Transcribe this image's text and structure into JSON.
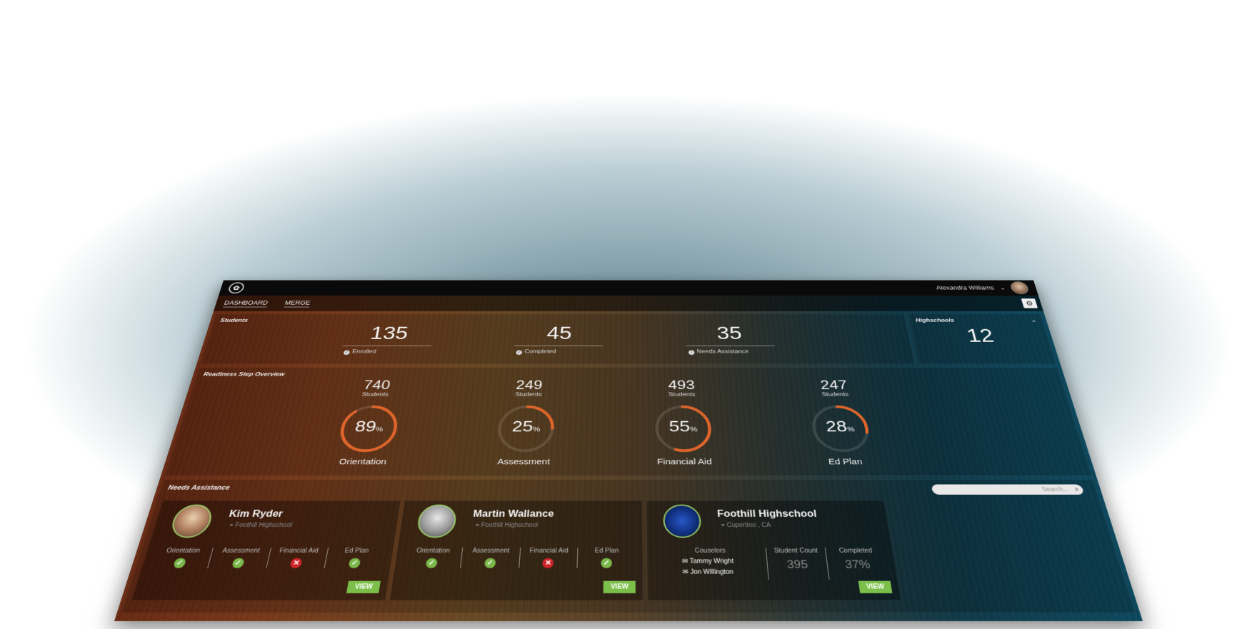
{
  "header": {
    "user_name": "Alexandra Williams",
    "user_menu_chevron": "⌄"
  },
  "nav": {
    "tabs": [
      {
        "label": "DASHBOARD"
      },
      {
        "label": "MERGE"
      }
    ]
  },
  "students": {
    "title": "Students",
    "stats": [
      {
        "value": "135",
        "label": "Enrolled"
      },
      {
        "value": "45",
        "label": "Completed"
      },
      {
        "value": "35",
        "label": "Needs Assistance"
      }
    ]
  },
  "highschools": {
    "title": "Highschools",
    "value": "12"
  },
  "readiness": {
    "title": "Readiness Step Overview",
    "steps": [
      {
        "count": "740",
        "sub": "Students",
        "percent": 89,
        "percent_label": "89",
        "name": "Orientation"
      },
      {
        "count": "249",
        "sub": "Students",
        "percent": 25,
        "percent_label": "25",
        "name": "Assessment"
      },
      {
        "count": "493",
        "sub": "Students",
        "percent": 55,
        "percent_label": "55",
        "name": "Financial Aid"
      },
      {
        "count": "247",
        "sub": "Students",
        "percent": 28,
        "percent_label": "28",
        "name": "Ed Plan"
      }
    ],
    "percent_sign": "%"
  },
  "needs": {
    "title": "Needs Assistance",
    "search_placeholder": "Search...",
    "cards": [
      {
        "name": "Kim Ryder",
        "location": "Foothill Highschool",
        "checks": [
          {
            "label": "Orientation",
            "status": "ok"
          },
          {
            "label": "Assessment",
            "status": "ok"
          },
          {
            "label": "Financial Aid",
            "status": "bad"
          },
          {
            "label": "Ed Plan",
            "status": "ok"
          }
        ],
        "view_label": "VIEW"
      },
      {
        "name": "Martin Wallance",
        "location": "Foothill Highschool",
        "checks": [
          {
            "label": "Orientation",
            "status": "ok"
          },
          {
            "label": "Assessment",
            "status": "ok"
          },
          {
            "label": "Financial Aid",
            "status": "bad"
          },
          {
            "label": "Ed Plan",
            "status": "ok"
          }
        ],
        "view_label": "VIEW"
      }
    ],
    "school_card": {
      "name": "Foothill Highschool",
      "location": "Cupertino , CA",
      "counselors_label": "Couselors",
      "counselors": [
        "Tammy Wright",
        "Jon Willington"
      ],
      "student_count_label": "Student Count",
      "student_count": "395",
      "completed_label": "Completed",
      "completed": "37%",
      "view_label": "VIEW"
    }
  },
  "colors": {
    "accent": "#e0652a",
    "ok": "#7ab84a",
    "bad": "#d0242a",
    "view": "#7bbf4a"
  }
}
